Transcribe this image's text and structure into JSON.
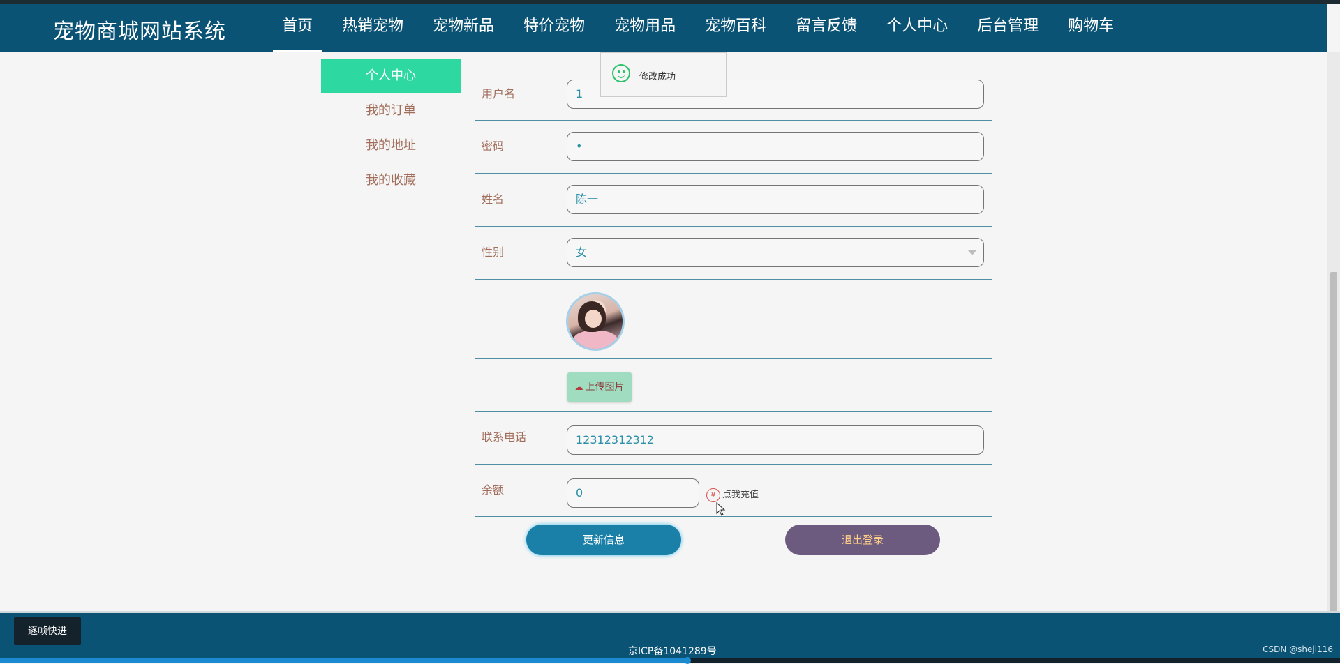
{
  "header": {
    "brand": "宠物商城网站系统",
    "nav": [
      "首页",
      "热销宠物",
      "宠物新品",
      "特价宠物",
      "宠物用品",
      "宠物百科",
      "留言反馈",
      "个人中心",
      "后台管理",
      "购物车"
    ],
    "active_index": 0
  },
  "sidebar": {
    "items": [
      "个人中心",
      "我的订单",
      "我的地址",
      "我的收藏"
    ],
    "active_index": 0
  },
  "toast": {
    "message": "修改成功"
  },
  "form": {
    "username_label": "用户名",
    "username_value": "1",
    "password_label": "密码",
    "password_value": "•",
    "name_label": "姓名",
    "name_value": "陈一",
    "gender_label": "性别",
    "gender_value": "女",
    "upload_label": "上传图片",
    "phone_label": "联系电话",
    "phone_value": "12312312312",
    "balance_label": "余额",
    "balance_value": "0",
    "recharge_label": "点我充值"
  },
  "buttons": {
    "update": "更新信息",
    "logout": "退出登录"
  },
  "footer": {
    "icp": "京ICP备1041289号",
    "frame_button": "逐帧快进",
    "watermark": "CSDN @sheji116"
  },
  "colors": {
    "nav_bg": "#0b5375",
    "sidebar_active": "#2dd9a0",
    "update_button": "#1a80a7",
    "logout_button": "#6c5b7f"
  }
}
